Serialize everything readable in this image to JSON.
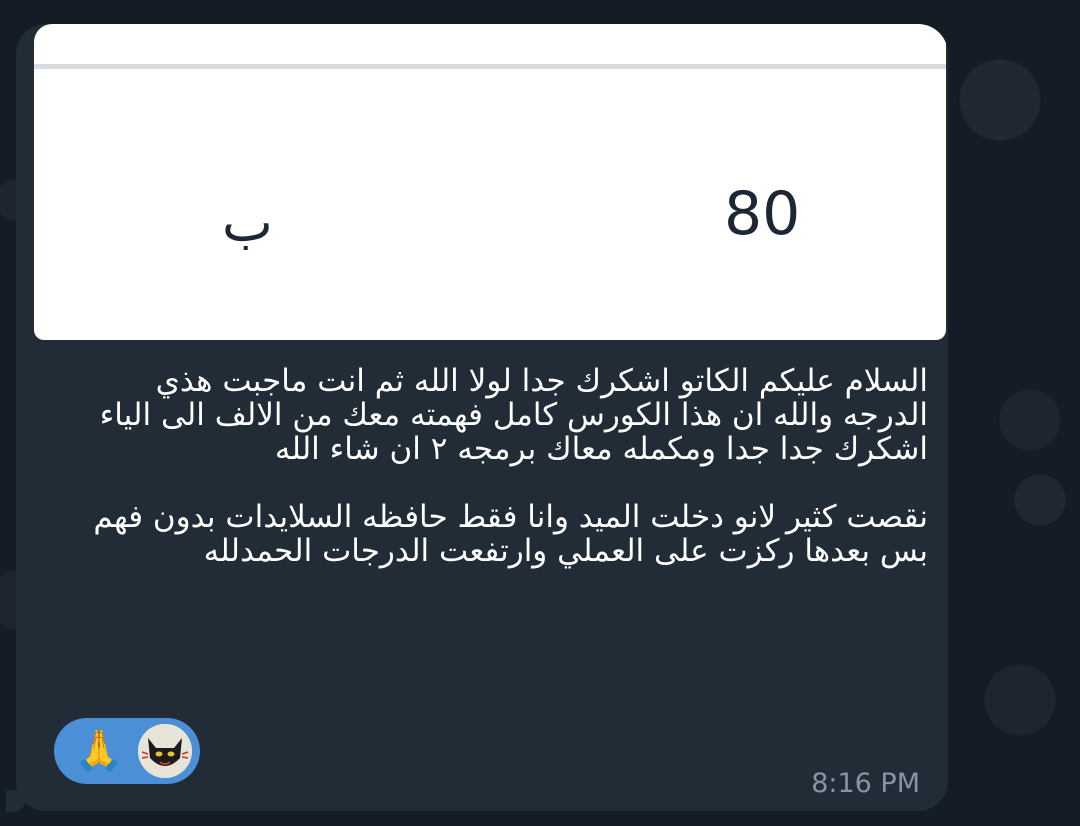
{
  "image_card": {
    "grade_number": "80",
    "grade_letter": "ب"
  },
  "message": {
    "paragraph_1": "السلام عليكم الكاتو اشكرك جدا لولا الله ثم انت ماجبت هذي الدرجه والله ان هذا الكورس كامل فهمته معك من الالف الى الياء اشكرك جدا جدا ومكمله معاك برمجه ٢ ان شاء الله",
    "paragraph_2": "نقصت كثير لانو دخلت الميد وانا فقط حافظه السلايدات بدون فهم بس بعدها ركزت على العملي وارتفعت الدرجات الحمدلله",
    "time": "8:16 PM"
  },
  "reactions": {
    "emoji": "🙏",
    "emoji_icon": "folded-hands-icon",
    "avatar_icon": "black-cat-avatar"
  },
  "colors": {
    "bubble": "#222c37",
    "background": "#141d26",
    "reaction_pill": "#4b8fd6",
    "timestamp": "#8695a4"
  }
}
